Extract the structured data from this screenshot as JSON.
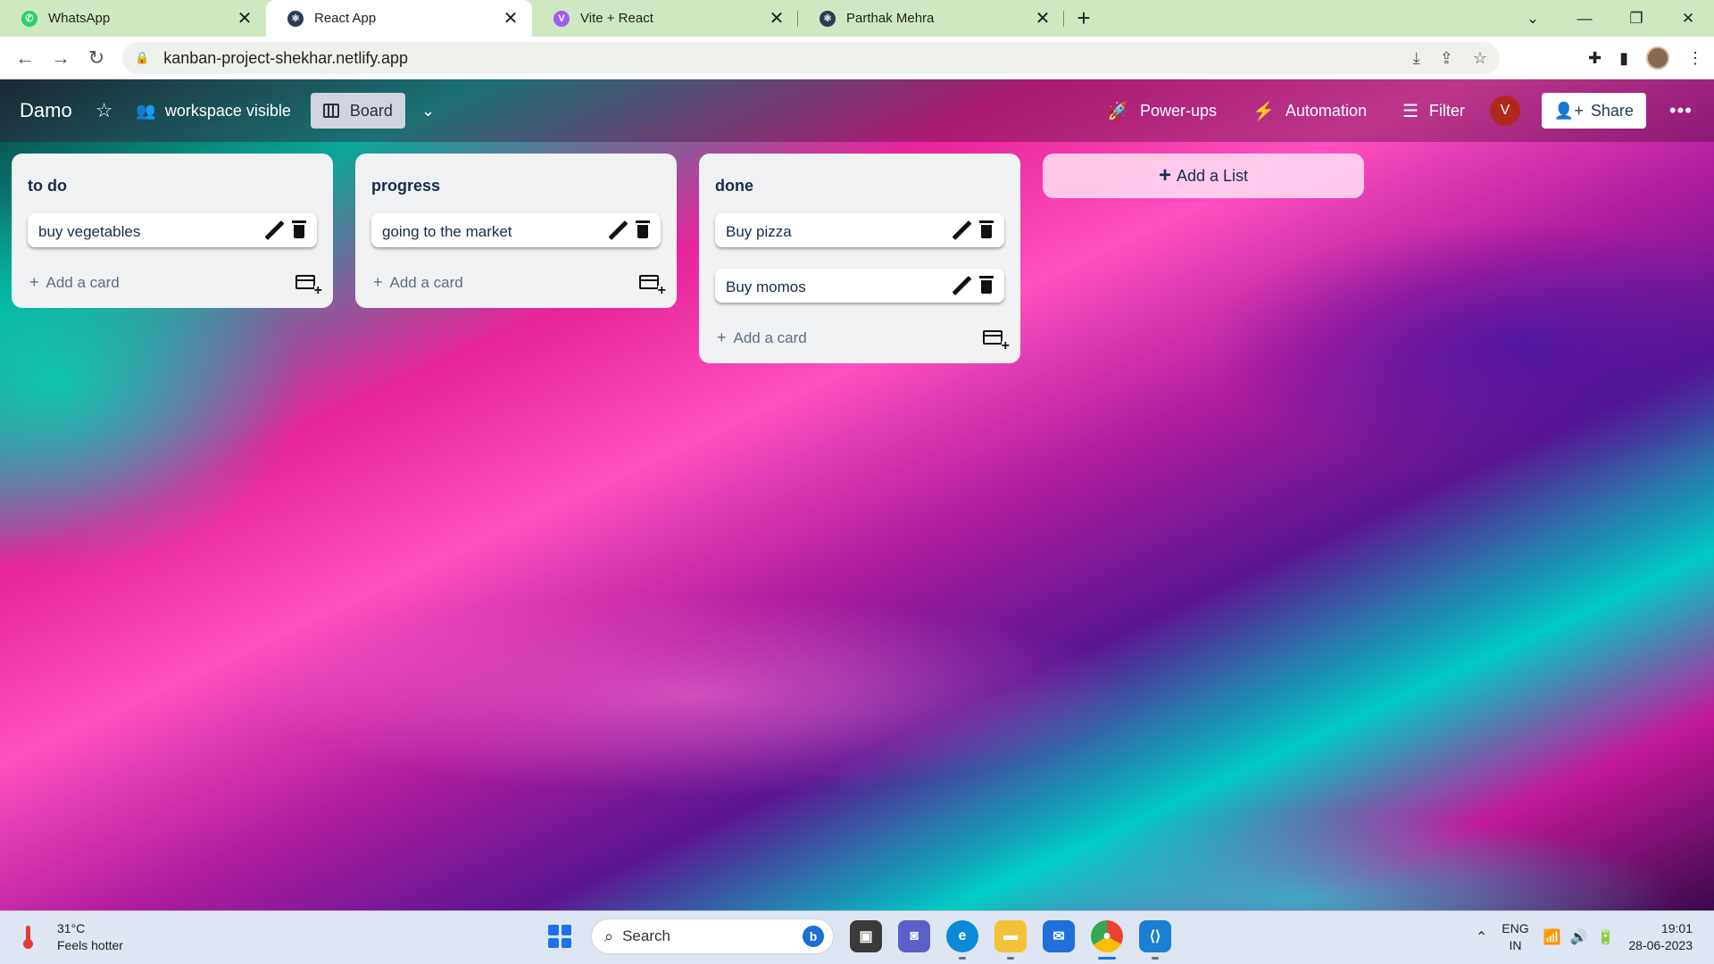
{
  "browser": {
    "tabs": [
      {
        "title": "WhatsApp",
        "icon": "whatsapp-icon",
        "color": "#25d366",
        "active": false
      },
      {
        "title": "React App",
        "icon": "react-icon",
        "color": "#2b3a55",
        "active": true
      },
      {
        "title": "Vite + React",
        "icon": "vite-icon",
        "color": "#a05cf5",
        "active": false
      },
      {
        "title": "Parthak Mehra",
        "icon": "react-icon",
        "color": "#2b3a55",
        "active": false
      }
    ],
    "url": "kanban-project-shekhar.netlify.app"
  },
  "header": {
    "board_title": "Damo",
    "workspace_label": "workspace visible",
    "board_button": "Board",
    "powerups": "Power-ups",
    "automation": "Automation",
    "filter": "Filter",
    "avatar_initial": "V",
    "share": "Share"
  },
  "lists": [
    {
      "title": "to do",
      "cards": [
        "buy vegetables"
      ],
      "add_card": "Add a card"
    },
    {
      "title": "progress",
      "cards": [
        "going to the market"
      ],
      "add_card": "Add a card"
    },
    {
      "title": "done",
      "cards": [
        "Buy pizza",
        "Buy momos"
      ],
      "add_card": "Add a card"
    }
  ],
  "add_list": "Add a List",
  "taskbar": {
    "temperature": "31°C",
    "weather_note": "Feels hotter",
    "search": "Search",
    "lang_1": "ENG",
    "lang_2": "IN",
    "time": "19:01",
    "date": "28-06-2023"
  },
  "colors": {
    "accent": "#1a73e8",
    "avatar": "#b0281c",
    "list_bg": "#f1f2f4"
  }
}
